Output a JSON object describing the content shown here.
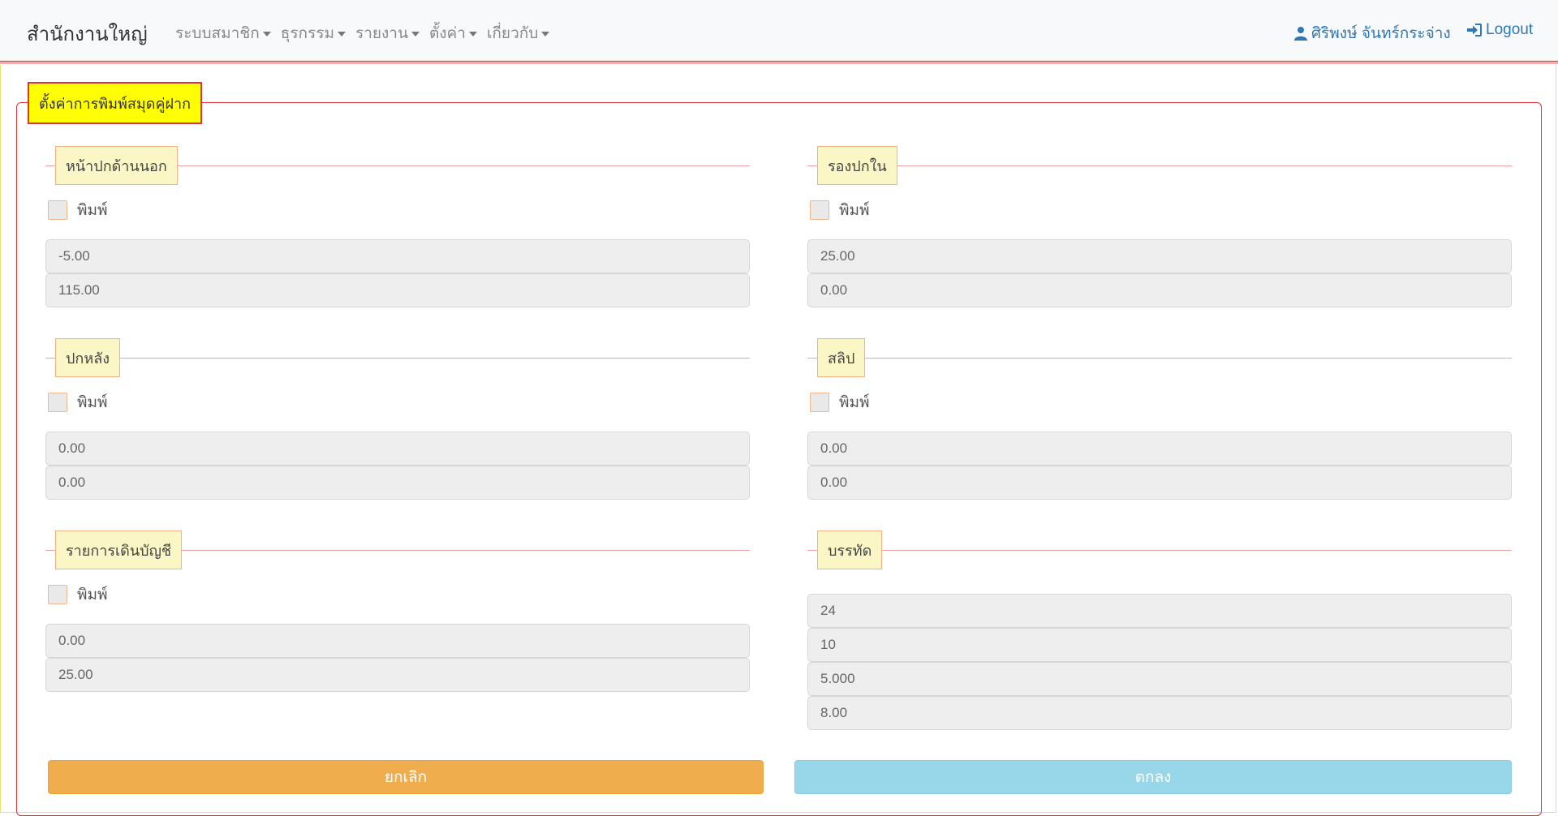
{
  "navbar": {
    "brand": "สำนักงานใหญ่",
    "menu": [
      "ระบบสมาชิก",
      "ธุรกรรม",
      "รายงาน",
      "ตั้งค่า",
      "เกี่ยวกับ"
    ],
    "user_name": "ศิริพงษ์ จันทร์กระจ่าง",
    "logout": "Logout"
  },
  "form": {
    "title": "ตั้งค่าการพิมพ์สมุดคู่ฝาก",
    "print_label": "พิมพ์",
    "sections": {
      "front_cover": {
        "title": "หน้าปกด้านนอก",
        "print_checked": false,
        "fields": [
          "-5.00",
          "115.00"
        ]
      },
      "inner_cover": {
        "title": "รองปกใน",
        "print_checked": false,
        "fields": [
          "25.00",
          "0.00"
        ]
      },
      "back_cover": {
        "title": "ปกหลัง",
        "print_checked": false,
        "fields": [
          "0.00",
          "0.00"
        ]
      },
      "slip": {
        "title": "สลิป",
        "print_checked": false,
        "fields": [
          "0.00",
          "0.00"
        ]
      },
      "transactions": {
        "title": "รายการเดินบัญชี",
        "print_checked": false,
        "fields": [
          "0.00",
          "25.00"
        ]
      },
      "lines": {
        "title": "บรรทัด",
        "fields": [
          "24",
          "10",
          "5.000",
          "8.00"
        ]
      }
    },
    "cancel_label": "ยกเลิก",
    "ok_label": "ตกลง"
  },
  "colors": {
    "accent_red": "#e0323a",
    "legend_yellow": "#ffff00",
    "cancel_orange": "#f0ad4e",
    "ok_blue": "#98d6ea",
    "link_blue": "#2f77b5"
  }
}
